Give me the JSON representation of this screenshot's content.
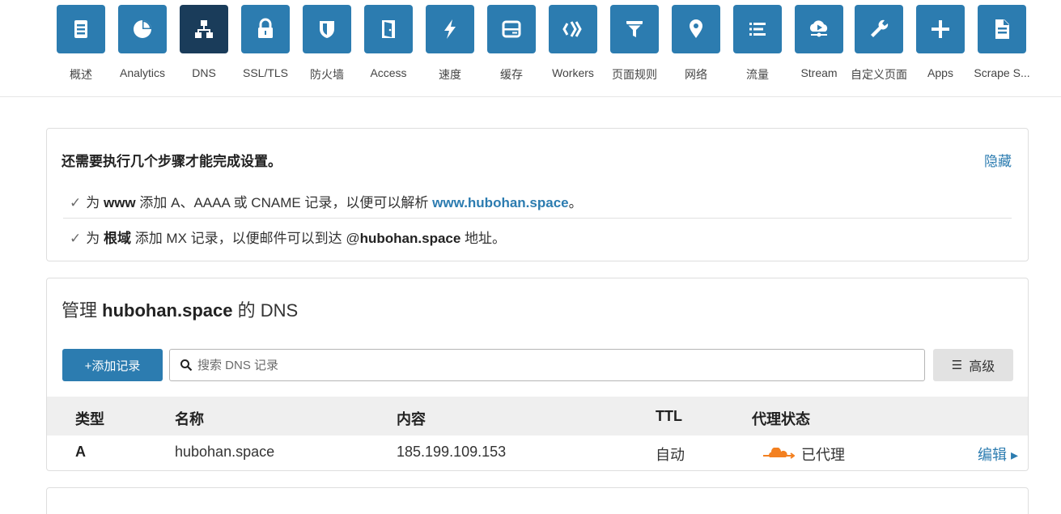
{
  "nav": {
    "items": [
      {
        "label": "概述",
        "icon": "document-icon",
        "active": false
      },
      {
        "label": "Analytics",
        "icon": "pie-chart-icon",
        "active": false
      },
      {
        "label": "DNS",
        "icon": "network-icon",
        "active": true
      },
      {
        "label": "SSL/TLS",
        "icon": "lock-icon",
        "active": false
      },
      {
        "label": "防火墙",
        "icon": "shield-icon",
        "active": false
      },
      {
        "label": "Access",
        "icon": "door-icon",
        "active": false
      },
      {
        "label": "速度",
        "icon": "lightning-icon",
        "active": false
      },
      {
        "label": "缓存",
        "icon": "drive-icon",
        "active": false
      },
      {
        "label": "Workers",
        "icon": "workers-icon",
        "active": false
      },
      {
        "label": "页面规则",
        "icon": "filter-icon",
        "active": false
      },
      {
        "label": "网络",
        "icon": "location-pin-icon",
        "active": false
      },
      {
        "label": "流量",
        "icon": "list-icon",
        "active": false
      },
      {
        "label": "Stream",
        "icon": "cloud-play-icon",
        "active": false
      },
      {
        "label": "自定义页面",
        "icon": "wrench-icon",
        "active": false
      },
      {
        "label": "Apps",
        "icon": "plus-icon",
        "active": false
      },
      {
        "label": "Scrape S...",
        "icon": "file-icon",
        "active": false
      }
    ],
    "tile_color": "#2c7cb0",
    "active_tile_color": "#1a3c5a"
  },
  "setup": {
    "title": "还需要执行几个步骤才能完成设置。",
    "hide_label": "隐藏",
    "step1": {
      "check": "✓",
      "pre": "为 ",
      "bold": "www",
      "mid": " 添加 A、AAAA 或 CNAME 记录，以便可以解析 ",
      "link": "www.hubohan.space",
      "post": "。"
    },
    "step2": {
      "check": "✓",
      "pre": "为 ",
      "bold": "根域",
      "mid": " 添加 MX 记录，以便邮件可以到达 @",
      "bold2": "hubohan.space",
      "post": " 地址。"
    }
  },
  "dns": {
    "title_pre": "管理 ",
    "title_domain": "hubohan.space",
    "title_post": " 的 DNS",
    "add_label": "+添加记录",
    "search_placeholder": "搜索 DNS 记录",
    "advanced_label": "高级",
    "advanced_icon": "☰",
    "columns": {
      "type": "类型",
      "name": "名称",
      "content": "内容",
      "ttl": "TTL",
      "proxy": "代理状态"
    },
    "records": [
      {
        "type": "A",
        "name": "hubohan.space",
        "content": "185.199.109.153",
        "ttl": "自动",
        "proxy": "已代理",
        "edit": "编辑 ▸"
      }
    ],
    "accent_color": "#2c7cb0",
    "proxy_color": "#f38020"
  }
}
